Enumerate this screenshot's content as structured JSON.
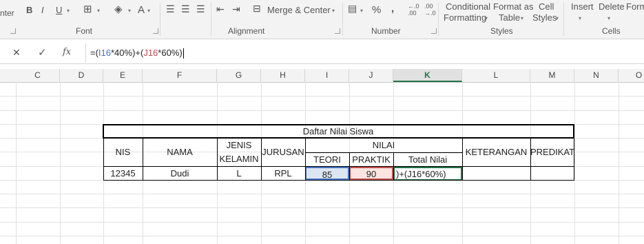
{
  "ribbon": {
    "left_cut_label": "nter",
    "font_buttons": {
      "bold": "B",
      "italic": "I",
      "underline": "U",
      "font_color": "A"
    },
    "merge_center": "Merge & Center",
    "percent": "%",
    "comma": ",",
    "dec_inc": "←.0 .00",
    "dec_dec": ".00 →.0",
    "conditional_formatting": [
      "Conditional",
      "Formatting"
    ],
    "format_as_table": [
      "Format as",
      "Table"
    ],
    "cell_styles": [
      "Cell",
      "Styles"
    ],
    "insert": "Insert",
    "delete": "Delete",
    "format_cut": "Form",
    "groups": {
      "font": "Font",
      "alignment": "Alignment",
      "number": "Number",
      "styles": "Styles",
      "cells": "Cells"
    }
  },
  "formula_bar": {
    "cancel": "✕",
    "enter": "✓",
    "fx": "fx",
    "formula_parts": [
      {
        "text": "=(",
        "color": "#222222"
      },
      {
        "text": "I16",
        "color": "#4472c4"
      },
      {
        "text": "*40%)+(",
        "color": "#222222"
      },
      {
        "text": "J16",
        "color": "#c0504d"
      },
      {
        "text": "*60%)",
        "color": "#222222"
      }
    ]
  },
  "columns": [
    "C",
    "D",
    "E",
    "F",
    "G",
    "H",
    "I",
    "J",
    "K",
    "L",
    "M",
    "N",
    "O"
  ],
  "active_column": "K",
  "table": {
    "title": "Daftar Nilai Siswa",
    "headers": {
      "nis": "NIS",
      "nama": "NAMA",
      "jenis": "JENIS",
      "kelamin": "KELAMIN",
      "jurusan": "JURUSAN",
      "nilai": "NILAI",
      "teori": "TEORI",
      "praktik": "PRAKTIK",
      "total": "Total Nilai",
      "keterangan": "KETERANGAN",
      "predikat": "PREDIKAT"
    },
    "row": {
      "nis": "12345",
      "nama": "Dudi",
      "jk": "L",
      "jurusan": "RPL",
      "teori": "85",
      "praktik": "90",
      "total_edit": ")+(J16*60%)",
      "keterangan": "",
      "predikat": ""
    }
  },
  "colors": {
    "accent": "#217346",
    "ref_blue": "#4472c4",
    "ref_red": "#c0504d"
  }
}
